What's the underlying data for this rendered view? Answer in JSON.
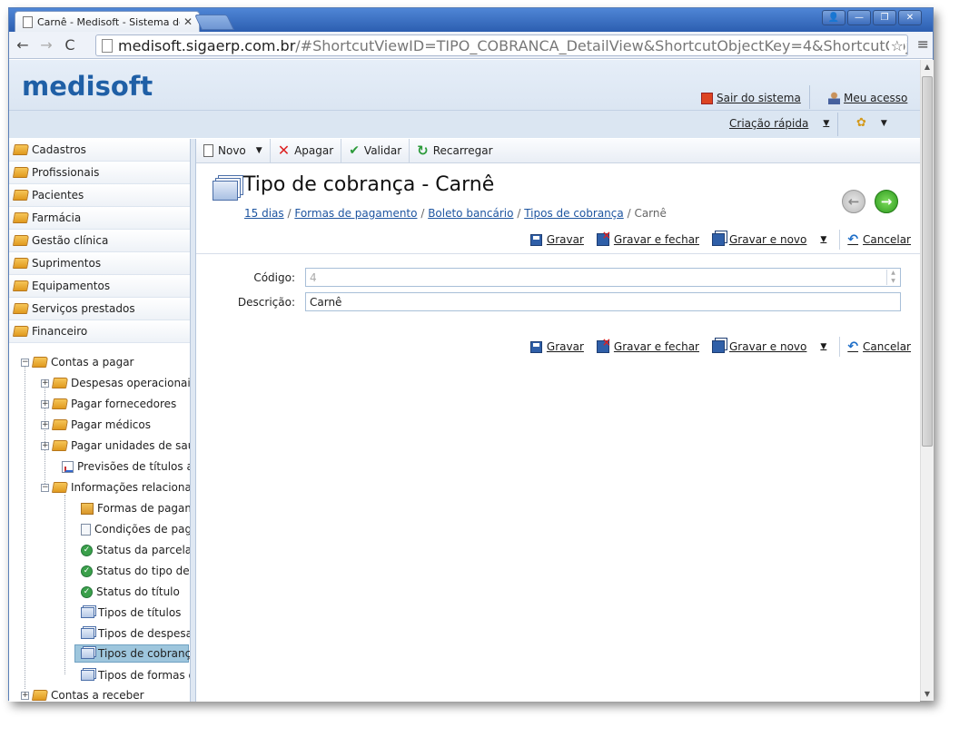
{
  "browser": {
    "tab_title": "Carnê - Medisoft - Sistema de",
    "tab_close": "✕",
    "url_main": "medisoft.sigaerp.com.br",
    "url_rest": "/#ShortcutViewID=TIPO_COBRANCA_DetailView&ShortcutObjectKey=4&ShortcutObjectClassN"
  },
  "header": {
    "logo": "medisoft",
    "logout": "Sair do sistema",
    "my_access": "Meu acesso",
    "quick_create": "Criação rápida"
  },
  "nav_groups": [
    "Cadastros",
    "Profissionais",
    "Pacientes",
    "Farmácia",
    "Gestão clínica",
    "Suprimentos",
    "Equipamentos",
    "Serviços prestados",
    "Financeiro"
  ],
  "tree": {
    "contas_pagar": "Contas a pagar",
    "despesas": "Despesas operacionais",
    "pagar_fornecedores": "Pagar fornecedores",
    "pagar_medicos": "Pagar médicos",
    "pagar_unidades": "Pagar unidades de saú",
    "previsoes": "Previsões de títulos a p",
    "informacoes": "Informações relacionac",
    "formas": "Formas de pagame",
    "condicoes": "Condições de paga",
    "status_parcela": "Status da parcela c",
    "status_tipo": "Status do tipo de ‹",
    "status_titulo": "Status do título",
    "tipos_titulos": "Tipos de títulos",
    "tipos_despesa": "Tipos de despesa",
    "tipos_cobranca": "Tipos de cobrança",
    "tipos_formas": "Tipos de formas de",
    "contas_receber": "Contas a receber"
  },
  "toolbar": {
    "novo": "Novo",
    "apagar": "Apagar",
    "validar": "Validar",
    "recarregar": "Recarregar"
  },
  "page": {
    "title": "Tipo de cobrança - Carnê",
    "breadcrumb": [
      "15 dias",
      "Formas de pagamento",
      "Boleto bancário",
      "Tipos de cobrança"
    ],
    "breadcrumb_current": "Carnê",
    "breadcrumb_sep": "/"
  },
  "actions": {
    "gravar": "Gravar",
    "gravar_fechar": "Gravar e fechar",
    "gravar_novo": "Gravar e novo",
    "cancelar": "Cancelar"
  },
  "form": {
    "codigo_label": "Código:",
    "codigo_value": "4",
    "descricao_label": "Descrição:",
    "descricao_value": "Carnê"
  }
}
